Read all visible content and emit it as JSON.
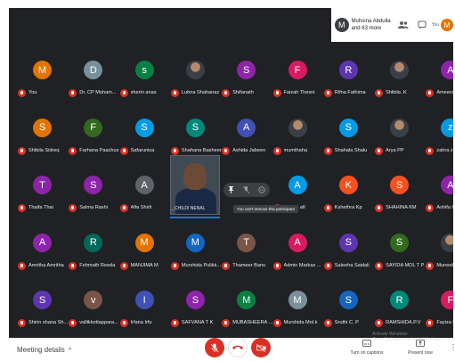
{
  "banner": {
    "avatar_letter": "M",
    "text": "Muhsina Abdulla and 63 more",
    "people_icon": "people-icon",
    "chat_icon": "chat-icon",
    "you_label": "You",
    "you_letter": "M"
  },
  "participants": [
    {
      "name": "You",
      "letter": "M",
      "color": "#e37400"
    },
    {
      "name": "Dr. CP Moham...",
      "letter": "D",
      "color": "#78909c"
    },
    {
      "name": "sherin anas",
      "letter": "s",
      "color": "#0b8043"
    },
    {
      "name": "Lubna Shahanaz",
      "letter": "",
      "color": "#5f6368",
      "photo": true
    },
    {
      "name": "Shifanath",
      "letter": "S",
      "color": "#8e24aa"
    },
    {
      "name": "Faizah Thesni",
      "letter": "F",
      "color": "#d81b60"
    },
    {
      "name": "Rifna Fathima",
      "letter": "R",
      "color": "#5e35b1"
    },
    {
      "name": "Shibila .K",
      "letter": "",
      "color": "#5f6368",
      "photo": true
    },
    {
      "name": "Ameera Nasr",
      "letter": "A",
      "color": "#8e24aa"
    },
    {
      "name": "Shibila Sidreq",
      "letter": "S",
      "color": "#e37400"
    },
    {
      "name": "Farhana Paachus",
      "letter": "F",
      "color": "#33691e"
    },
    {
      "name": "Safarunisa",
      "letter": "S",
      "color": "#039be5"
    },
    {
      "name": "Shahana Basheer",
      "letter": "S",
      "color": "#00897b"
    },
    {
      "name": "Ashida Jabeen",
      "letter": "A",
      "color": "#3f51b5"
    },
    {
      "name": "mumthaha",
      "letter": "",
      "color": "#5f6368",
      "photo": true
    },
    {
      "name": "Shahala Shalu",
      "letter": "S",
      "color": "#039be5"
    },
    {
      "name": "Arya PP",
      "letter": "",
      "color": "#5f6368",
      "photo": true
    },
    {
      "name": "zahra zuhra",
      "letter": "z",
      "color": "#039be5"
    },
    {
      "name": "Thaifa Thai",
      "letter": "T",
      "color": "#8e24aa"
    },
    {
      "name": "Salma Rashi",
      "letter": "S",
      "color": "#8e24aa"
    },
    {
      "name": "Alfa Shirli",
      "letter": "A",
      "color": "#5f6368"
    },
    {
      "name": "",
      "letter": "",
      "color": "transparent",
      "hidden": true
    },
    {
      "name": "",
      "letter": "",
      "color": "transparent",
      "hidden": true
    },
    {
      "name": "Lifeefa afi",
      "letter": "A",
      "color": "#039be5"
    },
    {
      "name": "Kshethra Kp",
      "letter": "K",
      "color": "#f4511e"
    },
    {
      "name": "SHAHINA KM",
      "letter": "S",
      "color": "#f4511e"
    },
    {
      "name": "Ashifa Cp",
      "letter": "A",
      "color": "#8e24aa"
    },
    {
      "name": "Amritha Amritha",
      "letter": "A",
      "color": "#8e24aa"
    },
    {
      "name": "Fehmath Reeda",
      "letter": "R",
      "color": "#00695c"
    },
    {
      "name": "MANJIMA M",
      "letter": "M",
      "color": "#e37400"
    },
    {
      "name": "Murshida Pulikk...",
      "letter": "M",
      "color": "#1565c0"
    },
    {
      "name": "Thameer Banu",
      "letter": "T",
      "color": "#795548"
    },
    {
      "name": "Admin Markaz ...",
      "letter": "A",
      "color": "#d81b60"
    },
    {
      "name": "Saleeha Saidali",
      "letter": "S",
      "color": "#5e35b1"
    },
    {
      "name": "SAYIDA MOL T P",
      "letter": "S",
      "color": "#33691e"
    },
    {
      "name": "Muneeba Ashi",
      "letter": "",
      "color": "#5f6368",
      "photo": true
    },
    {
      "name": "Shirin shana Sh...",
      "letter": "S",
      "color": "#5e35b1"
    },
    {
      "name": "vallikkottappara...",
      "letter": "v",
      "color": "#795548"
    },
    {
      "name": "Irfana Irfu",
      "letter": "I",
      "color": "#3f51b5"
    },
    {
      "name": "SAFVANA T K",
      "letter": "S",
      "color": "#8e24aa"
    },
    {
      "name": "MUBASHEERA ...",
      "letter": "M",
      "color": "#0b8043"
    },
    {
      "name": "Murshida Mol.k",
      "letter": "M",
      "color": "#78909c"
    },
    {
      "name": "Sruthi C. P",
      "letter": "S",
      "color": "#1565c0"
    },
    {
      "name": "RAMSHIDA.P.V",
      "letter": "R",
      "color": "#00897b"
    },
    {
      "name": "Fayiza Fazz",
      "letter": "F",
      "color": "#d81b60"
    }
  ],
  "pinned": {
    "name": "CHILDI NENAL",
    "more": "...",
    "tooltip": "You can't remove this participant"
  },
  "bottombar": {
    "meeting_details": "Meeting details",
    "chevron": "^",
    "mic_icon": "🎙",
    "leave_icon": "☎",
    "cam_icon": "🎥",
    "captions_label": "Turn on captions",
    "present_label": "Present now",
    "more_icon": "⋮"
  },
  "watermark": {
    "line1": "Activate Windows",
    "line2": "Go to Settings to activate Windows."
  }
}
